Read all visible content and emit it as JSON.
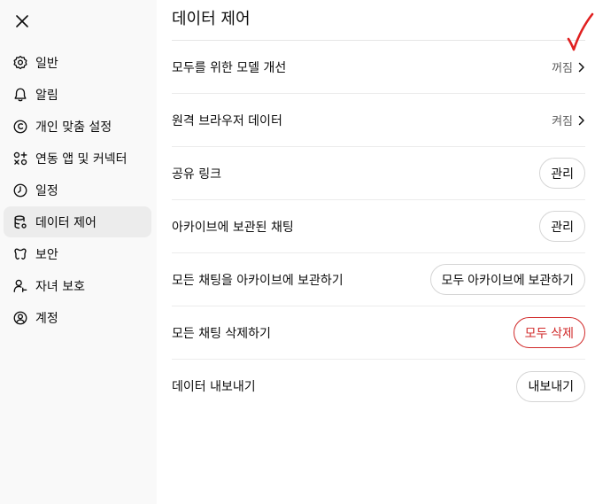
{
  "sidebar": {
    "items": [
      {
        "label": "일반",
        "icon": "gear-icon"
      },
      {
        "label": "알림",
        "icon": "bell-icon"
      },
      {
        "label": "개인 맞춤 설정",
        "icon": "personalization-icon"
      },
      {
        "label": "연동 앱 및 커넥터",
        "icon": "apps-icon"
      },
      {
        "label": "일정",
        "icon": "clock-icon"
      },
      {
        "label": "데이터 제어",
        "icon": "database-icon",
        "active": true
      },
      {
        "label": "보안",
        "icon": "shield-icon"
      },
      {
        "label": "자녀 보호",
        "icon": "parental-icon"
      },
      {
        "label": "계정",
        "icon": "account-icon"
      }
    ]
  },
  "main": {
    "title": "데이터 제어",
    "rows": [
      {
        "label": "모두를 위한 모델 개선",
        "value": "꺼짐"
      },
      {
        "label": "원격 브라우저 데이터",
        "value": "켜짐"
      },
      {
        "label": "공유 링크",
        "button": "관리"
      },
      {
        "label": "아카이브에 보관된 채팅",
        "button": "관리"
      },
      {
        "label": "모든 채팅을 아카이브에 보관하기",
        "button": "모두 아카이브에 보관하기"
      },
      {
        "label": "모든 채팅 삭제하기",
        "button": "모두 삭제"
      },
      {
        "label": "데이터 내보내기",
        "button": "내보내기"
      }
    ]
  },
  "colors": {
    "sidebar_bg": "#f9f9f9",
    "active_bg": "#ececec",
    "danger": "#d12a2a",
    "annotation": "#e02020"
  }
}
